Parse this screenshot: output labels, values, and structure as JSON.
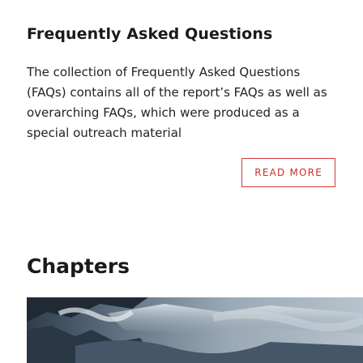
{
  "faq": {
    "title": "Frequently Asked Questions",
    "body": "The collection of Frequently Asked Questions (FAQs) contains all of the report’s FAQs as well as overarching FAQs, which were produced as a special outreach material",
    "read_more_label": "READ MORE"
  },
  "chapters": {
    "title": "Chapters"
  },
  "colors": {
    "accent": "#c9302c",
    "text": "#1f1f1f"
  }
}
